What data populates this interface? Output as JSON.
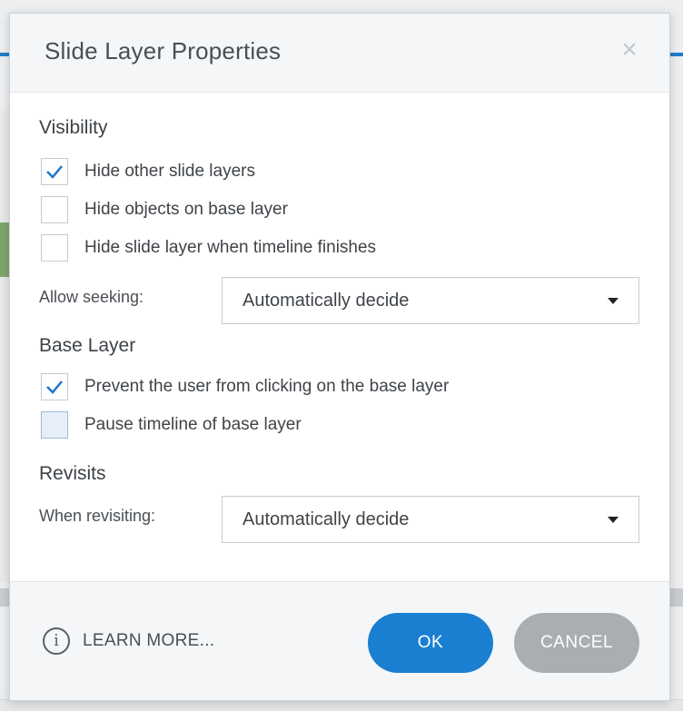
{
  "dialog": {
    "title": "Slide Layer Properties",
    "close_glyph": "×"
  },
  "visibility": {
    "title": "Visibility",
    "options": [
      {
        "label": "Hide other slide layers",
        "checked": true
      },
      {
        "label": "Hide objects on base layer",
        "checked": false
      },
      {
        "label": "Hide slide layer when timeline finishes",
        "checked": false
      }
    ],
    "seeking_label": "Allow seeking:",
    "seeking_value": "Automatically decide"
  },
  "base_layer": {
    "title": "Base Layer",
    "options": [
      {
        "label": "Prevent the user from clicking on the base layer",
        "checked": true
      },
      {
        "label": "Pause timeline of base layer",
        "checked": false
      }
    ]
  },
  "revisits": {
    "title": "Revisits",
    "revisiting_label": "When revisiting:",
    "revisiting_value": "Automatically decide"
  },
  "footer": {
    "learn_more_label": "LEARN MORE...",
    "info_glyph": "i",
    "ok_label": "OK",
    "cancel_label": "CANCEL"
  },
  "colors": {
    "accent": "#1a7fd0",
    "check": "#1f76c6",
    "cancel": "#a9aeb3"
  }
}
